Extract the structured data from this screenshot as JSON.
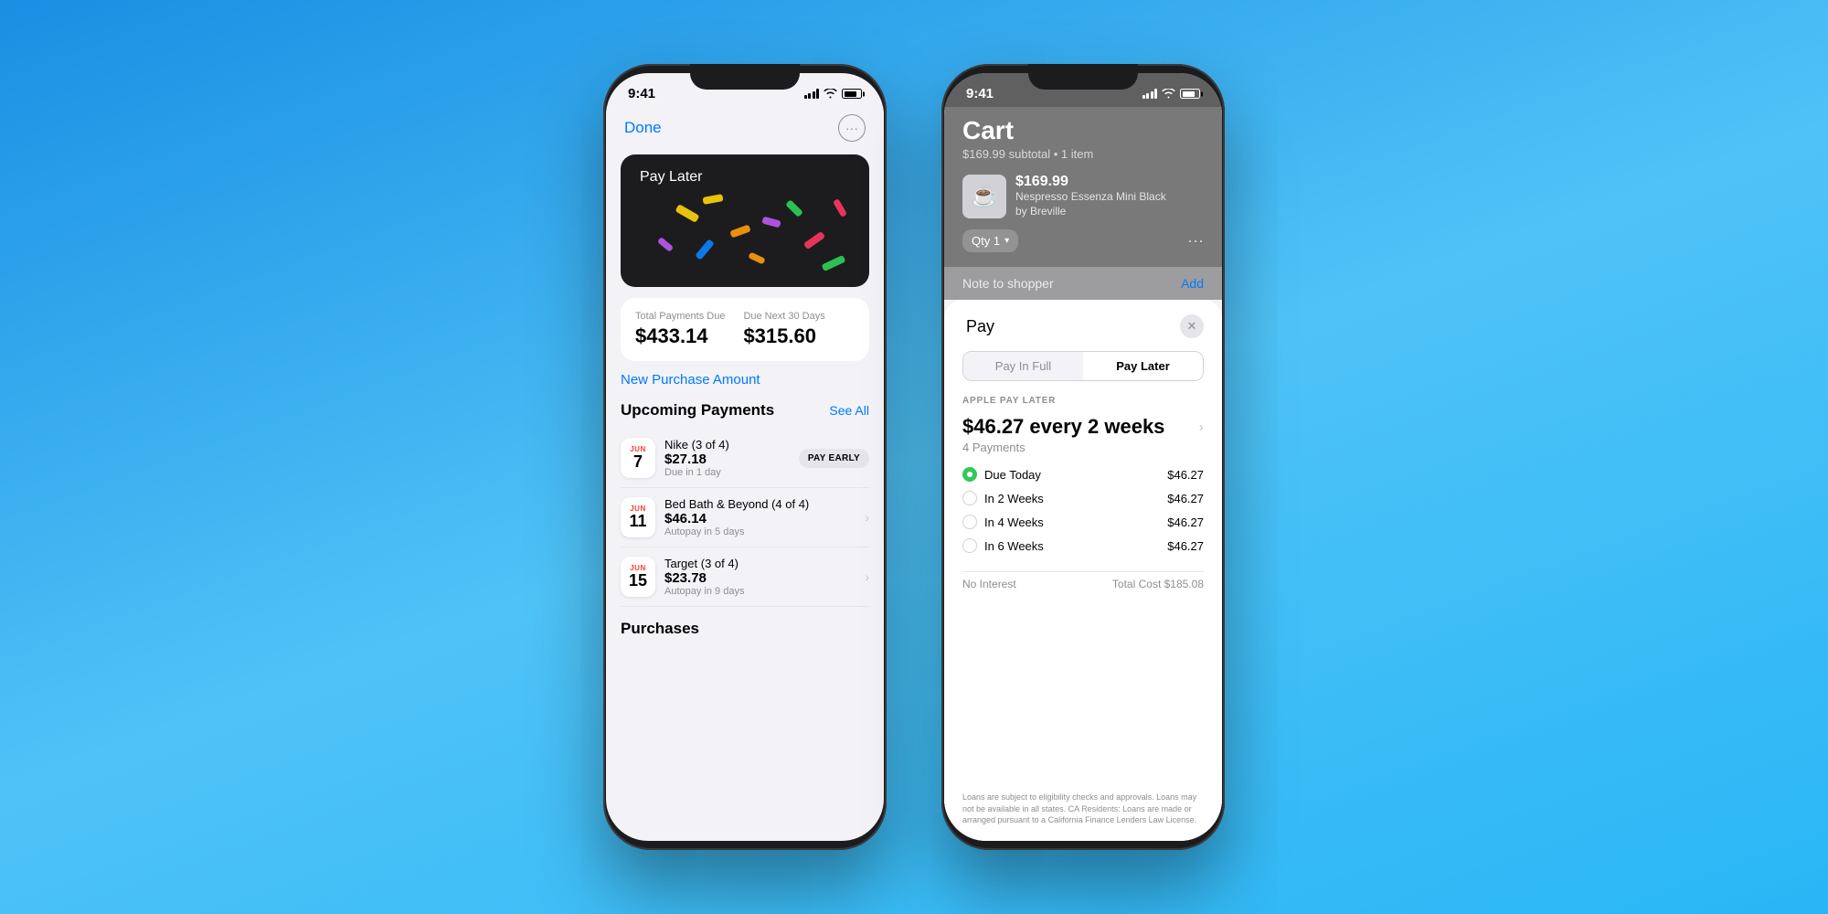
{
  "background": "#3aa6e8",
  "phone1": {
    "status": {
      "time": "9:41",
      "signal": "signal-bars",
      "wifi": "wifi",
      "battery": "battery"
    },
    "nav": {
      "done_label": "Done",
      "more_label": "···"
    },
    "card": {
      "logo_apple": "",
      "logo_text": "Pay Later"
    },
    "payment_summary": {
      "total_label": "Total Payments Due",
      "total_amount": "$433.14",
      "next_label": "Due Next 30 Days",
      "next_amount": "$315.60"
    },
    "new_purchase_label": "New Purchase Amount",
    "upcoming": {
      "section_title": "Upcoming Payments",
      "see_all": "See All",
      "items": [
        {
          "month": "JUN",
          "day": "7",
          "merchant": "Nike (3 of 4)",
          "amount": "$27.18",
          "sub": "Due in 1 day",
          "action": "PAY EARLY"
        },
        {
          "month": "JUN",
          "day": "11",
          "merchant": "Bed Bath & Beyond (4 of 4)",
          "amount": "$46.14",
          "sub": "Autopay in 5 days",
          "action": "chevron"
        },
        {
          "month": "JUN",
          "day": "15",
          "merchant": "Target (3 of 4)",
          "amount": "$23.78",
          "sub": "Autopay in 9 days",
          "action": "chevron"
        }
      ]
    },
    "purchases_label": "Purchases"
  },
  "phone2": {
    "status": {
      "time": "9:41",
      "signal": "signal-bars",
      "wifi": "wifi",
      "battery": "battery"
    },
    "cart": {
      "title": "Cart",
      "subtitle": "$169.99 subtotal • 1 item",
      "item": {
        "price": "$169.99",
        "name": "Nespresso Essenza Mini Black",
        "brand": "by Breville"
      },
      "qty_label": "Qty 1",
      "note_label": "Note to shopper",
      "add_label": "Add"
    },
    "apple_pay": {
      "logo_text": "Pay",
      "tabs": {
        "pay_full": "Pay In Full",
        "pay_later": "Pay Later",
        "active": "pay_later"
      },
      "section_label": "APPLE PAY LATER",
      "frequency": "$46.27 every 2 weeks",
      "payment_count": "4 Payments",
      "schedule": [
        {
          "label": "Due Today",
          "amount": "$46.27",
          "checked": true
        },
        {
          "label": "In 2 Weeks",
          "amount": "$46.27",
          "checked": false
        },
        {
          "label": "In 4 Weeks",
          "amount": "$46.27",
          "checked": false
        },
        {
          "label": "In 6 Weeks",
          "amount": "$46.27",
          "checked": false
        }
      ],
      "no_interest": "No Interest",
      "total_cost": "Total Cost $185.08",
      "legal": "Loans are subject to eligibility checks and approvals. Loans may not be available in all states. CA Residents: Loans are made or arranged pursuant to a California Finance Lenders Law License."
    }
  }
}
